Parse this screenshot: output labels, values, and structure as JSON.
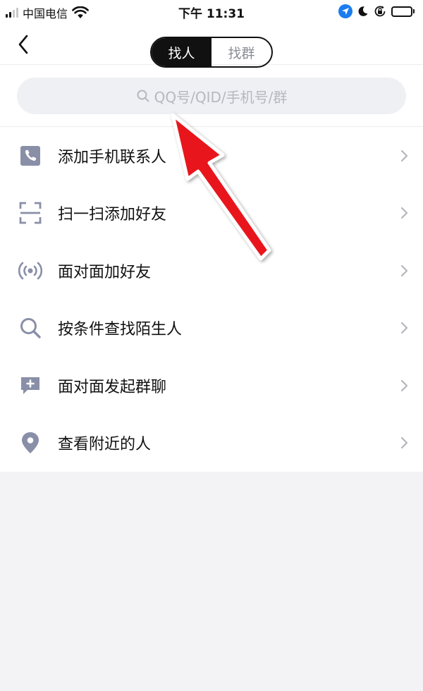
{
  "status_bar": {
    "carrier": "中国电信",
    "time": "下午 11:31",
    "battery_level": 0.85,
    "icons": [
      "signal-icon",
      "wifi-icon",
      "location-icon",
      "moon-icon",
      "orientation-lock-icon",
      "battery-icon"
    ]
  },
  "nav": {
    "tabs": [
      {
        "label": "找人",
        "active": true
      },
      {
        "label": "找群",
        "active": false
      }
    ]
  },
  "search": {
    "placeholder": "QQ号/QID/手机号/群"
  },
  "menu": {
    "items": [
      {
        "label": "添加手机联系人",
        "icon": "phone-contact-icon"
      },
      {
        "label": "扫一扫添加好友",
        "icon": "scan-icon"
      },
      {
        "label": "面对面加好友",
        "icon": "face-to-face-signal-icon"
      },
      {
        "label": "按条件查找陌生人",
        "icon": "search-icon"
      },
      {
        "label": "面对面发起群聊",
        "icon": "chat-plus-icon"
      },
      {
        "label": "查看附近的人",
        "icon": "location-pin-icon"
      }
    ]
  },
  "colors": {
    "icon": "#8a8fa8",
    "background": "#f3f3f6",
    "active_tab": "#111111",
    "annotation_arrow": "#e8131b"
  }
}
